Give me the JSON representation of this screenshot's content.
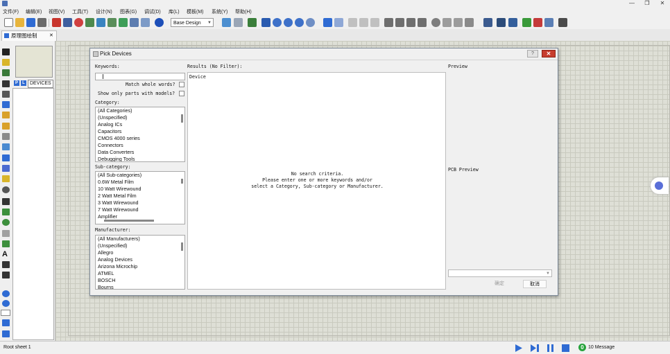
{
  "window": {
    "minimize": "—",
    "maximize": "❐",
    "close": "✕"
  },
  "menubar": {
    "items": [
      "文件(F)",
      "编辑(E)",
      "视图(V)",
      "工具(T)",
      "设计(N)",
      "图表(G)",
      "调试(D)",
      "库(L)",
      "模板(M)",
      "系统(Y)",
      "帮助(H)"
    ]
  },
  "toolbar": {
    "mode_select": "Base Design"
  },
  "tab": {
    "label": "原理图绘制",
    "close": "✕"
  },
  "object_panel": {
    "p_button": "P",
    "l_button": "L",
    "label": "DEVICES"
  },
  "status": {
    "sheet": "Root sheet 1",
    "messages_count": "0",
    "messages": "10 Message"
  },
  "colors": {
    "accent": "#2f6bd3",
    "close_red": "#c73d2f",
    "ok_green": "#27a33c"
  },
  "dialog": {
    "title": "Pick Devices",
    "help": "?",
    "close": "✕",
    "keywords_label": "Keywords:",
    "match_whole_words": "Match whole words?",
    "show_only_models": "Show only parts with models?",
    "category_label": "Category:",
    "categories": [
      "(All Categories)",
      "(Unspecified)",
      "Analog ICs",
      "Capacitors",
      "CMOS 4000 series",
      "Connectors",
      "Data Converters",
      "Debugging Tools"
    ],
    "subcategory_label": "Sub-category:",
    "subcategories": [
      "(All Sub-categories)",
      "0.6W Metal Film",
      "10 Watt Wirewound",
      "2 Watt Metal Film",
      "3 Watt Wirewound",
      "7 Watt Wirewound",
      "Amplifier"
    ],
    "manufacturer_label": "Manufacturer:",
    "manufacturers": [
      "(All Manufacturers)",
      "(Unspecified)",
      "Allegro",
      "Analog Devices",
      "Arizona Microchip",
      "ATMEL",
      "BOSCH",
      "Bourns"
    ],
    "results_label": "Results (No Filter):",
    "results_col": "Device",
    "no_criteria": [
      "No search criteria.",
      "Please enter one or more keywords and/or",
      "select a Category, Sub-category or Manufacturer."
    ],
    "preview_label": "Preview",
    "pcb_preview_label": "PCB Preview",
    "ok": "确定",
    "cancel": "取消"
  }
}
